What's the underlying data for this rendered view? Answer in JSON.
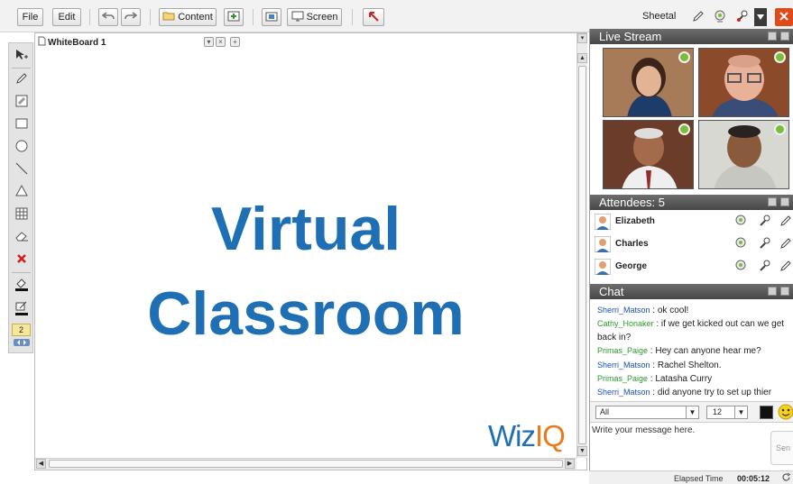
{
  "toolbar": {
    "file_label": "File",
    "edit_label": "Edit",
    "content_label": "Content",
    "screen_label": "Screen",
    "user_name": "Sheetal"
  },
  "whiteboard": {
    "tab_title": "WhiteBoard 1",
    "title_line1": "Virtual",
    "title_line2": "Classroom",
    "logo_part1": "Wiz",
    "logo_part2": "IQ"
  },
  "palette": {
    "page_number": "2"
  },
  "live_stream": {
    "title": "Live Stream"
  },
  "attendees": {
    "title": "Attendees: 5",
    "items": [
      {
        "name": "Elizabeth"
      },
      {
        "name": "Charles"
      },
      {
        "name": "George"
      }
    ]
  },
  "chat": {
    "title": "Chat",
    "messages": [
      {
        "name": "Sherri_Matson",
        "text": "ok cool!"
      },
      {
        "name": "Cathy_Honaker",
        "text": "if we get kicked out can we get back in?"
      },
      {
        "name": "Primas_Paige",
        "text": "Hey can anyone hear me?"
      },
      {
        "name": "Sherri_Matson",
        "text": "Rachel Shelton."
      },
      {
        "name": "Primas_Paige",
        "text": "Latasha Curry"
      },
      {
        "name": "Sherri_Matson",
        "text": "did anyone try to set up thier"
      }
    ],
    "recipient": "All",
    "font_size": "12",
    "input_placeholder": "Write your message here.",
    "send_label": "Sen"
  },
  "status": {
    "elapsed_label": "Elapsed Time",
    "elapsed_value": "00:05:12"
  },
  "colors": {
    "title_blue": "#1f6fb5",
    "logo_orange": "#e87b1e",
    "panel_header": "#555555",
    "name_blue": "#1b4fb8",
    "name_green": "#2a9a2a"
  }
}
